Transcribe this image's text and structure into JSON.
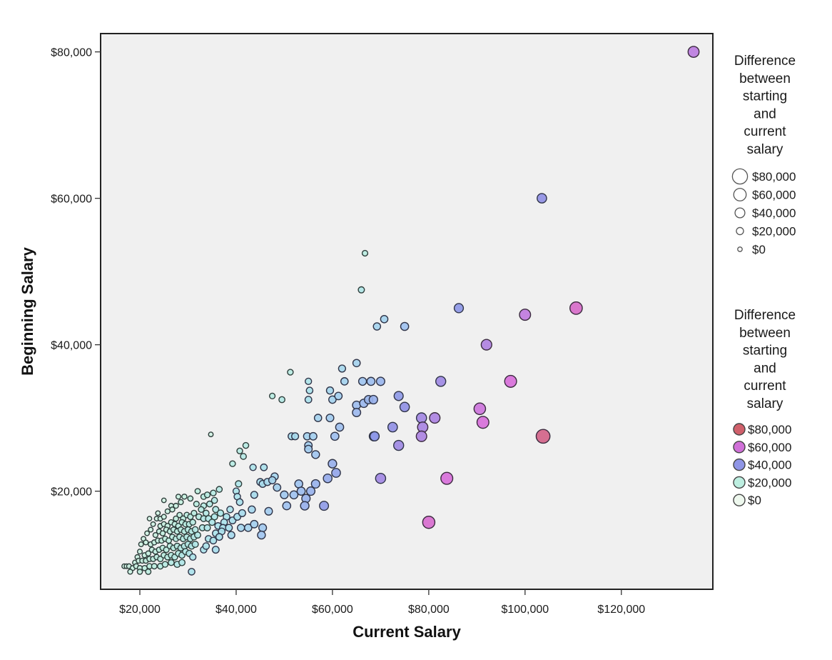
{
  "chart_data": {
    "type": "scatter",
    "title": "",
    "xlabel": "Current Salary",
    "ylabel": "Beginning Salary",
    "xlim": [
      11850,
      139000
    ],
    "ylim": [
      6600,
      82500
    ],
    "grid": false,
    "x_ticks": [
      {
        "value": 20000,
        "label": "$20,000"
      },
      {
        "value": 40000,
        "label": "$40,000"
      },
      {
        "value": 60000,
        "label": "$60,000"
      },
      {
        "value": 80000,
        "label": "$80,000"
      },
      {
        "value": 100000,
        "label": "$100,000"
      },
      {
        "value": 120000,
        "label": "$120,000"
      }
    ],
    "y_ticks": [
      {
        "value": 20000,
        "label": "$20,000"
      },
      {
        "value": 40000,
        "label": "$40,000"
      },
      {
        "value": 60000,
        "label": "$60,000"
      },
      {
        "value": 80000,
        "label": "$80,000"
      }
    ],
    "size_legend": {
      "title_lines": [
        "Difference",
        "between",
        "starting",
        "and",
        "current",
        "salary"
      ],
      "items": [
        {
          "value": 80000,
          "label": "$80,000"
        },
        {
          "value": 60000,
          "label": "$60,000"
        },
        {
          "value": 40000,
          "label": "$40,000"
        },
        {
          "value": 20000,
          "label": "$20,000"
        },
        {
          "value": 0,
          "label": "$0"
        }
      ],
      "placement": "right-top"
    },
    "color_legend": {
      "title_lines": [
        "Difference",
        "between",
        "starting",
        "and",
        "current",
        "salary"
      ],
      "items": [
        {
          "value": 80000,
          "label": "$80,000",
          "color": "#d0606b"
        },
        {
          "value": 60000,
          "label": "$60,000",
          "color": "#d070d8"
        },
        {
          "value": 40000,
          "label": "$40,000",
          "color": "#8f95e6"
        },
        {
          "value": 20000,
          "label": "$20,000",
          "color": "#bdeee0"
        },
        {
          "value": 0,
          "label": "$0",
          "color": "#eef8ee"
        }
      ],
      "placement": "right-bottom"
    },
    "size_and_color_variable": "Difference between starting and current salary",
    "points": [
      [
        135000,
        80000
      ],
      [
        103500,
        60000
      ],
      [
        110600,
        45000
      ],
      [
        86250,
        45000
      ],
      [
        100000,
        44100
      ],
      [
        92000,
        40000
      ],
      [
        97000,
        35000
      ],
      [
        82500,
        35000
      ],
      [
        103750,
        27500
      ],
      [
        90600,
        31250
      ],
      [
        91250,
        29400
      ],
      [
        83750,
        21750
      ],
      [
        80000,
        15750
      ],
      [
        70000,
        21750
      ],
      [
        73750,
        26250
      ],
      [
        72500,
        28750
      ],
      [
        75000,
        31500
      ],
      [
        73750,
        33000
      ],
      [
        78500,
        30000
      ],
      [
        81250,
        30000
      ],
      [
        78750,
        28750
      ],
      [
        78500,
        27500
      ],
      [
        68750,
        27500
      ],
      [
        68600,
        27500
      ],
      [
        58250,
        18000
      ],
      [
        70000,
        35000
      ],
      [
        68500,
        32500
      ],
      [
        67500,
        32500
      ],
      [
        66500,
        32000
      ],
      [
        66250,
        35000
      ],
      [
        68000,
        35000
      ],
      [
        65000,
        31750
      ],
      [
        65000,
        30750
      ],
      [
        65000,
        37500
      ],
      [
        62000,
        36750
      ],
      [
        62500,
        35000
      ],
      [
        61250,
        33000
      ],
      [
        60000,
        32500
      ],
      [
        59500,
        33750
      ],
      [
        57000,
        30000
      ],
      [
        59500,
        30000
      ],
      [
        60500,
        27500
      ],
      [
        61500,
        28750
      ],
      [
        56000,
        27500
      ],
      [
        54750,
        27500
      ],
      [
        55000,
        26250
      ],
      [
        55000,
        25750
      ],
      [
        56500,
        25000
      ],
      [
        60000,
        23750
      ],
      [
        60750,
        22500
      ],
      [
        59000,
        21750
      ],
      [
        56500,
        21000
      ],
      [
        55500,
        20000
      ],
      [
        54500,
        19000
      ],
      [
        53500,
        20000
      ],
      [
        53000,
        21000
      ],
      [
        54250,
        18000
      ],
      [
        52000,
        19500
      ],
      [
        50000,
        19500
      ],
      [
        50500,
        18000
      ],
      [
        48500,
        20500
      ],
      [
        48000,
        22000
      ],
      [
        47500,
        21500
      ],
      [
        46500,
        21250
      ],
      [
        45500,
        21000
      ],
      [
        45000,
        21250
      ],
      [
        46750,
        17250
      ],
      [
        45500,
        15000
      ],
      [
        45250,
        14000
      ],
      [
        43750,
        15500
      ],
      [
        43250,
        17500
      ],
      [
        42500,
        15000
      ],
      [
        41000,
        15000
      ],
      [
        43750,
        19500
      ],
      [
        43500,
        23250
      ],
      [
        45750,
        23250
      ],
      [
        42000,
        26250
      ],
      [
        40750,
        25500
      ],
      [
        41500,
        24750
      ],
      [
        39250,
        23750
      ],
      [
        47500,
        33000
      ],
      [
        49500,
        32500
      ],
      [
        51250,
        36250
      ],
      [
        51500,
        27500
      ],
      [
        52250,
        27500
      ],
      [
        55000,
        35000
      ],
      [
        55250,
        33750
      ],
      [
        55000,
        32500
      ],
      [
        66000,
        47500
      ],
      [
        66750,
        52500
      ],
      [
        69250,
        42500
      ],
      [
        70750,
        43500
      ],
      [
        75000,
        42500
      ],
      [
        34750,
        27750
      ],
      [
        40500,
        21000
      ],
      [
        40000,
        20000
      ],
      [
        40250,
        19250
      ],
      [
        40750,
        18500
      ],
      [
        38750,
        17500
      ],
      [
        38000,
        16500
      ],
      [
        37500,
        15750
      ],
      [
        37250,
        15000
      ],
      [
        38500,
        15000
      ],
      [
        39250,
        16000
      ],
      [
        40250,
        16500
      ],
      [
        41250,
        17000
      ],
      [
        36500,
        20250
      ],
      [
        35250,
        19750
      ],
      [
        34000,
        19500
      ],
      [
        33250,
        19250
      ],
      [
        35500,
        18750
      ],
      [
        34500,
        18250
      ],
      [
        33250,
        18000
      ],
      [
        35750,
        17500
      ],
      [
        36750,
        17000
      ],
      [
        35500,
        16500
      ],
      [
        34250,
        16250
      ],
      [
        33250,
        16250
      ],
      [
        35000,
        15750
      ],
      [
        36250,
        15250
      ],
      [
        34000,
        15000
      ],
      [
        33000,
        15000
      ],
      [
        35750,
        14250
      ],
      [
        36500,
        13750
      ],
      [
        34250,
        13500
      ],
      [
        33250,
        12000
      ],
      [
        33750,
        12500
      ],
      [
        35250,
        13250
      ],
      [
        31000,
        11000
      ],
      [
        30750,
        9000
      ],
      [
        32250,
        16500
      ],
      [
        31250,
        17000
      ],
      [
        30500,
        16500
      ],
      [
        29750,
        16750
      ],
      [
        29000,
        16250
      ],
      [
        28250,
        16750
      ],
      [
        27500,
        16250
      ],
      [
        31000,
        15750
      ],
      [
        30250,
        15500
      ],
      [
        29500,
        15500
      ],
      [
        28750,
        15750
      ],
      [
        28000,
        15250
      ],
      [
        27250,
        15500
      ],
      [
        26500,
        15750
      ],
      [
        25750,
        15250
      ],
      [
        25000,
        15500
      ],
      [
        24250,
        15250
      ],
      [
        31500,
        14750
      ],
      [
        30750,
        14500
      ],
      [
        30000,
        14750
      ],
      [
        29250,
        14500
      ],
      [
        28500,
        14750
      ],
      [
        27750,
        14500
      ],
      [
        27000,
        14750
      ],
      [
        26250,
        14500
      ],
      [
        25500,
        14750
      ],
      [
        24750,
        14250
      ],
      [
        24000,
        14500
      ],
      [
        23250,
        14000
      ],
      [
        32000,
        14000
      ],
      [
        31250,
        13750
      ],
      [
        30500,
        13500
      ],
      [
        29750,
        13750
      ],
      [
        29000,
        13500
      ],
      [
        28250,
        13750
      ],
      [
        27500,
        13500
      ],
      [
        26750,
        13750
      ],
      [
        26000,
        13250
      ],
      [
        25250,
        13500
      ],
      [
        24500,
        13250
      ],
      [
        23750,
        13250
      ],
      [
        23000,
        13000
      ],
      [
        22250,
        12750
      ],
      [
        31500,
        12750
      ],
      [
        30750,
        12500
      ],
      [
        30000,
        12750
      ],
      [
        29250,
        12500
      ],
      [
        28500,
        12250
      ],
      [
        27750,
        12500
      ],
      [
        27000,
        12250
      ],
      [
        26250,
        12500
      ],
      [
        25500,
        12000
      ],
      [
        24750,
        12250
      ],
      [
        24000,
        12000
      ],
      [
        23250,
        11750
      ],
      [
        22500,
        12000
      ],
      [
        21750,
        11500
      ],
      [
        21000,
        11250
      ],
      [
        30250,
        11500
      ],
      [
        29500,
        11750
      ],
      [
        28750,
        11250
      ],
      [
        28000,
        11500
      ],
      [
        27250,
        11000
      ],
      [
        26500,
        11250
      ],
      [
        25750,
        11000
      ],
      [
        25000,
        11250
      ],
      [
        24250,
        10750
      ],
      [
        23500,
        11000
      ],
      [
        22750,
        10750
      ],
      [
        22000,
        10750
      ],
      [
        21250,
        10500
      ],
      [
        20500,
        10500
      ],
      [
        19750,
        10500
      ],
      [
        19000,
        10250
      ],
      [
        28750,
        10250
      ],
      [
        27750,
        10000
      ],
      [
        26500,
        10250
      ],
      [
        25250,
        10000
      ],
      [
        24250,
        9750
      ],
      [
        23000,
        9750
      ],
      [
        22000,
        9750
      ],
      [
        21000,
        9500
      ],
      [
        20000,
        9500
      ],
      [
        19250,
        9750
      ],
      [
        18500,
        9500
      ],
      [
        17750,
        9750
      ],
      [
        17250,
        9750
      ],
      [
        16750,
        9750
      ],
      [
        18000,
        9000
      ],
      [
        20000,
        9000
      ],
      [
        21750,
        9000
      ],
      [
        29250,
        19250
      ],
      [
        28000,
        19250
      ],
      [
        30500,
        19000
      ],
      [
        27500,
        18000
      ],
      [
        28500,
        18500
      ],
      [
        26750,
        17500
      ],
      [
        25750,
        17250
      ],
      [
        25000,
        16500
      ],
      [
        24250,
        16250
      ],
      [
        23500,
        16250
      ],
      [
        22750,
        15500
      ],
      [
        22250,
        14750
      ],
      [
        21500,
        14250
      ],
      [
        20750,
        13500
      ],
      [
        20250,
        12750
      ],
      [
        22000,
        16250
      ],
      [
        23750,
        17000
      ],
      [
        21250,
        13000
      ],
      [
        20000,
        11750
      ],
      [
        19500,
        11000
      ],
      [
        25000,
        18750
      ],
      [
        26500,
        18000
      ],
      [
        32000,
        20000
      ],
      [
        33750,
        17000
      ],
      [
        32750,
        17500
      ],
      [
        31750,
        18250
      ],
      [
        37000,
        14500
      ],
      [
        39000,
        14000
      ],
      [
        35750,
        12000
      ]
    ]
  }
}
